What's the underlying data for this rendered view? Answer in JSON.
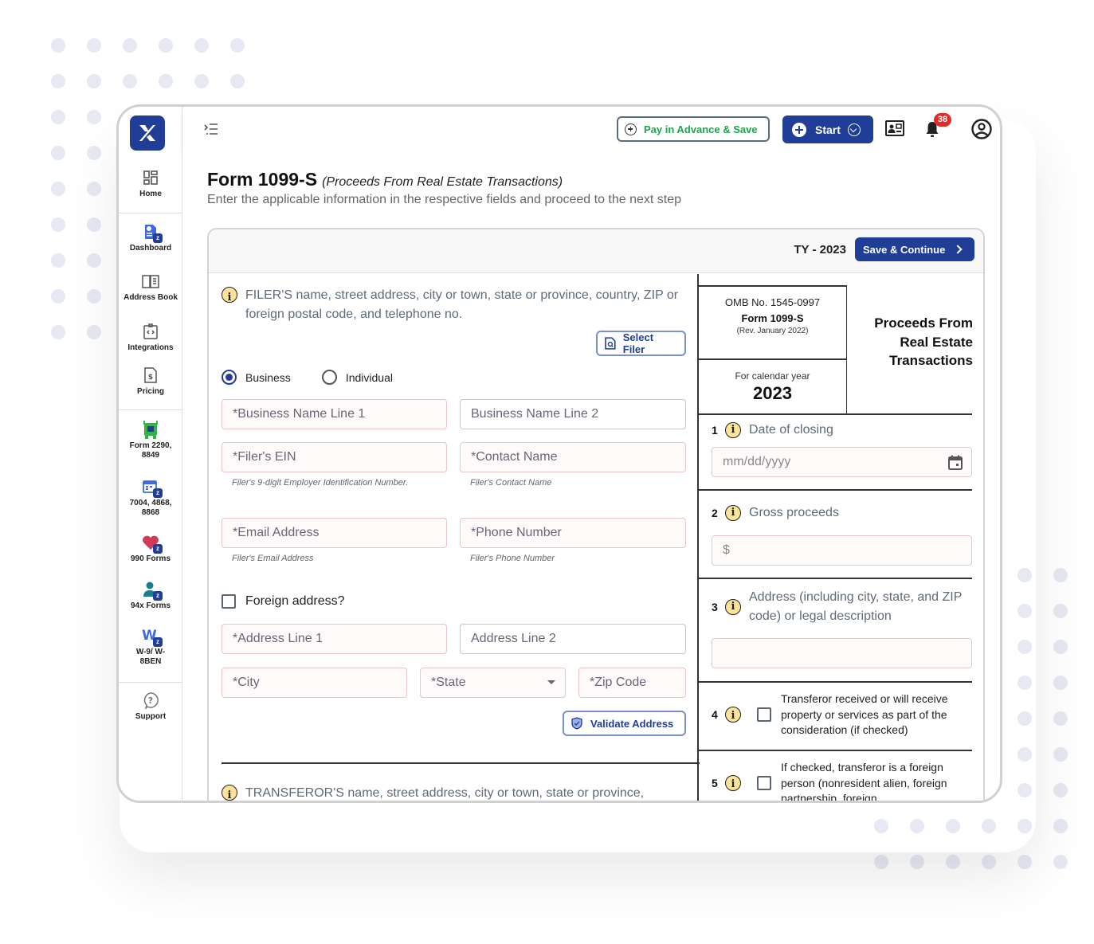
{
  "sidebar": {
    "items": [
      {
        "label": "Home",
        "icon": "home-grid-icon"
      },
      {
        "label": "Dashboard",
        "icon": "dashboard-icon"
      },
      {
        "label": "Address Book",
        "icon": "address-book-icon"
      },
      {
        "label": "Integrations",
        "icon": "integrations-icon"
      },
      {
        "label": "Pricing",
        "icon": "pricing-icon"
      },
      {
        "label": "Form 2290, 8849",
        "icon": "truck-icon"
      },
      {
        "label": "7004, 4868, 8868",
        "icon": "calendar-icon"
      },
      {
        "label": "990 Forms",
        "icon": "heart-icon"
      },
      {
        "label": "94x Forms",
        "icon": "person-icon"
      },
      {
        "label": "W-9/ W-8BEN",
        "icon": "w-letter-icon"
      },
      {
        "label": "Support",
        "icon": "help-icon"
      }
    ]
  },
  "topbar": {
    "pay_label": "Pay in Advance & Save",
    "start_label": "Start",
    "notification_count": "38"
  },
  "page": {
    "title": "Form 1099-S",
    "subtitle": "(Proceeds From Real Estate Transactions)",
    "description": "Enter the applicable information in the respective fields and proceed to the next step"
  },
  "card": {
    "tax_year": "TY - 2023",
    "save_label": "Save & Continue"
  },
  "filer": {
    "heading": "FILER'S name, street address, city or town, state or province, country, ZIP or foreign postal code, and telephone no.",
    "select_filer_label": "Select Filer",
    "type_options": [
      "Business",
      "Individual"
    ],
    "type_selected": "Business",
    "fields": {
      "business_name_1": "*Business Name Line 1",
      "business_name_2": "Business Name Line 2",
      "ein": "*Filer's EIN",
      "ein_hint": "Filer's 9-digit Employer Identification Number.",
      "contact_name": "*Contact Name",
      "contact_hint": "Filer's Contact Name",
      "email": "*Email Address",
      "email_hint": "Filer's Email Address",
      "phone": "*Phone Number",
      "phone_hint": "Filer's Phone Number",
      "foreign_address": "Foreign address?",
      "address_1": "*Address Line 1",
      "address_2": "Address Line 2",
      "city": "*City",
      "state": "*State",
      "zip": "*Zip Code"
    },
    "validate_label": "Validate Address"
  },
  "transferor": {
    "heading": "TRANSFEROR'S name, street address, city or town, state or province,"
  },
  "form_header": {
    "omb": "OMB No. 1545-0997",
    "form_name": "Form 1099-S",
    "revision": "(Rev. January 2022)",
    "calendar_label": "For calendar year",
    "calendar_year": "2023",
    "title": "Proceeds From Real Estate Transactions"
  },
  "boxes": [
    {
      "num": "1",
      "label": "Date of closing",
      "placeholder": "mm/dd/yyyy"
    },
    {
      "num": "2",
      "label": "Gross proceeds",
      "placeholder": "$"
    },
    {
      "num": "3",
      "label": "Address (including city, state, and ZIP code) or legal description",
      "placeholder": ""
    },
    {
      "num": "4",
      "label": "Transferor received or will receive property or services as part of the consideration (if checked)",
      "checked": false
    },
    {
      "num": "5",
      "label": "If checked, transferor is a foreign person (nonresident alien, foreign partnership, foreign",
      "checked": false
    }
  ]
}
